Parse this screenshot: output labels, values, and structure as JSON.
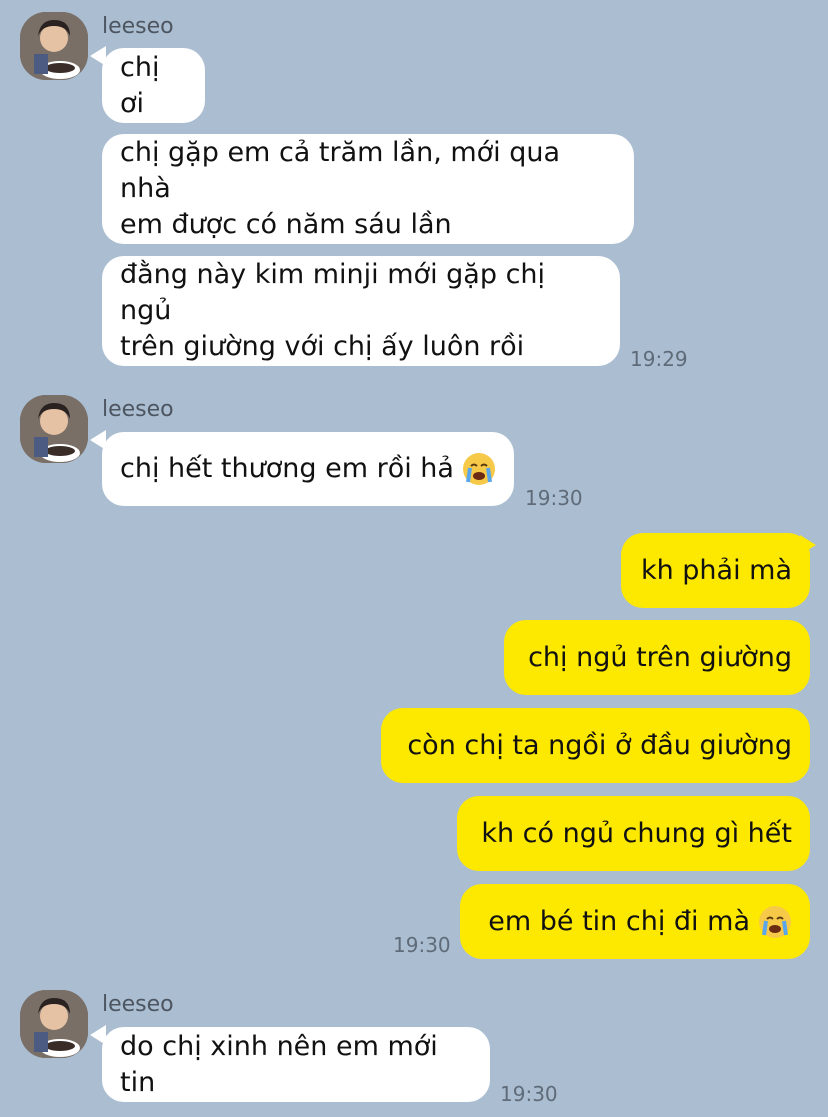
{
  "groups": [
    {
      "sender": "leeseo",
      "messages": [
        "chị ơi",
        "chị gặp em cả trăm lần, mới qua nhà\nem được có năm sáu lần",
        "đằng này kim minji mới gặp chị ngủ\ntrên giường với chị ấy luôn rồi"
      ],
      "time": "19:29"
    },
    {
      "sender": "leeseo",
      "messages": [
        "chị hết thương em rồi hả"
      ],
      "time": "19:30"
    },
    {
      "sender": "me",
      "messages": [
        "kh phải mà",
        "chị ngủ trên giường",
        "còn chị ta ngồi ở đầu giường",
        "kh có ngủ chung gì hết",
        "em bé tin chị đi mà"
      ],
      "time": "19:30"
    },
    {
      "sender": "leeseo",
      "messages": [
        "do chị xinh nên em mới tin"
      ],
      "time": "19:30"
    }
  ],
  "colors": {
    "background": "#aabdd1",
    "incoming": "#ffffff",
    "outgoing": "#fde800"
  },
  "icons": {
    "crying": "crying-emoji-icon"
  }
}
